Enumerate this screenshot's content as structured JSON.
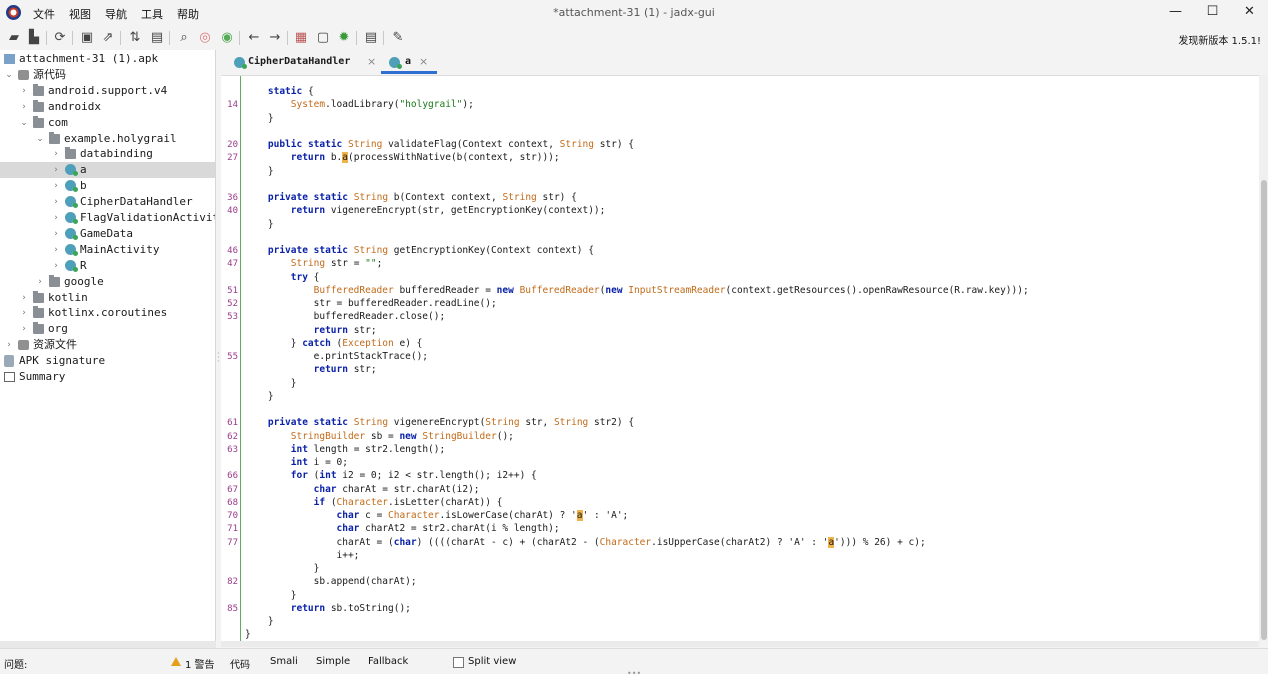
{
  "window": {
    "title": "*attachment-31 (1) - jadx-gui",
    "menu": [
      "文件",
      "视图",
      "导航",
      "工具",
      "帮助"
    ],
    "controls": {
      "minimize": "—",
      "maximize": "☐",
      "close": "✕"
    }
  },
  "toolbar": {
    "icons": [
      "open-file-icon",
      "add-files-icon",
      "reload-icon",
      "save-icon",
      "export-icon",
      "sync-tree-icon",
      "flatten-packages-icon",
      "search-icon",
      "find-class-icon",
      "find-usage-icon",
      "back-icon",
      "forward-icon",
      "deobfuscation-icon",
      "quick-tabs-icon",
      "debugger-icon",
      "log-viewer-icon",
      "preferences-icon"
    ],
    "update_notice": "发现新版本 1.5.1!"
  },
  "tree": {
    "items": [
      {
        "label": "attachment-31 (1).apk",
        "icon": "apk-icon",
        "depth": 0,
        "arrow": ""
      },
      {
        "label": "源代码",
        "icon": "package-icon",
        "depth": 0,
        "arrow": "⌄"
      },
      {
        "label": "android.support.v4",
        "icon": "folder-icon",
        "depth": 1,
        "arrow": "›"
      },
      {
        "label": "androidx",
        "icon": "folder-icon",
        "depth": 1,
        "arrow": "›"
      },
      {
        "label": "com",
        "icon": "folder-icon",
        "depth": 1,
        "arrow": "⌄"
      },
      {
        "label": "example.holygrail",
        "icon": "folder-icon",
        "depth": 2,
        "arrow": "⌄"
      },
      {
        "label": "databinding",
        "icon": "folder-icon",
        "depth": 3,
        "arrow": "›"
      },
      {
        "label": "a",
        "icon": "class-icon",
        "depth": 3,
        "arrow": "›",
        "selected": true
      },
      {
        "label": "b",
        "icon": "class-icon",
        "depth": 3,
        "arrow": "›"
      },
      {
        "label": "CipherDataHandler",
        "icon": "class-icon",
        "depth": 3,
        "arrow": "›"
      },
      {
        "label": "FlagValidationActivit",
        "icon": "class-icon",
        "depth": 3,
        "arrow": "›"
      },
      {
        "label": "GameData",
        "icon": "class-icon",
        "depth": 3,
        "arrow": "›"
      },
      {
        "label": "MainActivity",
        "icon": "class-icon",
        "depth": 3,
        "arrow": "›"
      },
      {
        "label": "R",
        "icon": "class-icon",
        "depth": 3,
        "arrow": "›"
      },
      {
        "label": "google",
        "icon": "folder-icon",
        "depth": 2,
        "arrow": "›"
      },
      {
        "label": "kotlin",
        "icon": "folder-icon",
        "depth": 1,
        "arrow": "›"
      },
      {
        "label": "kotlinx.coroutines",
        "icon": "folder-icon",
        "depth": 1,
        "arrow": "›"
      },
      {
        "label": "org",
        "icon": "folder-icon",
        "depth": 1,
        "arrow": "›"
      },
      {
        "label": "资源文件",
        "icon": "package-icon",
        "depth": 0,
        "arrow": "›"
      },
      {
        "label": "APK signature",
        "icon": "signature-icon",
        "depth": 0,
        "arrow": ""
      },
      {
        "label": "Summary",
        "icon": "summary-icon",
        "depth": 0,
        "arrow": ""
      }
    ]
  },
  "tabs": [
    {
      "label": "CipherDataHandler",
      "close": "×",
      "active": false
    },
    {
      "label": "a",
      "close": "×",
      "active": true
    }
  ],
  "code": {
    "lines": [
      {
        "num": "",
        "text": "    static {"
      },
      {
        "num": "14",
        "text": "        System.loadLibrary(\"holygrail\");"
      },
      {
        "num": "",
        "text": "    }"
      },
      {
        "num": "",
        "text": ""
      },
      {
        "num": "20",
        "text": "    public static String validateFlag(Context context, String str) {"
      },
      {
        "num": "27",
        "text": "        return b.a(processWithNative(b(context, str)));"
      },
      {
        "num": "",
        "text": "    }"
      },
      {
        "num": "",
        "text": ""
      },
      {
        "num": "36",
        "text": "    private static String b(Context context, String str) {"
      },
      {
        "num": "40",
        "text": "        return vigenereEncrypt(str, getEncryptionKey(context));"
      },
      {
        "num": "",
        "text": "    }"
      },
      {
        "num": "",
        "text": ""
      },
      {
        "num": "46",
        "text": "    private static String getEncryptionKey(Context context) {"
      },
      {
        "num": "47",
        "text": "        String str = \"\";"
      },
      {
        "num": "",
        "text": "        try {"
      },
      {
        "num": "51",
        "text": "            BufferedReader bufferedReader = new BufferedReader(new InputStreamReader(context.getResources().openRawResource(R.raw.key)));"
      },
      {
        "num": "52",
        "text": "            str = bufferedReader.readLine();"
      },
      {
        "num": "53",
        "text": "            bufferedReader.close();"
      },
      {
        "num": "",
        "text": "            return str;"
      },
      {
        "num": "",
        "text": "        } catch (Exception e) {"
      },
      {
        "num": "55",
        "text": "            e.printStackTrace();"
      },
      {
        "num": "",
        "text": "            return str;"
      },
      {
        "num": "",
        "text": "        }"
      },
      {
        "num": "",
        "text": "    }"
      },
      {
        "num": "",
        "text": ""
      },
      {
        "num": "61",
        "text": "    private static String vigenereEncrypt(String str, String str2) {"
      },
      {
        "num": "62",
        "text": "        StringBuilder sb = new StringBuilder();"
      },
      {
        "num": "63",
        "text": "        int length = str2.length();"
      },
      {
        "num": "",
        "text": "        int i = 0;"
      },
      {
        "num": "66",
        "text": "        for (int i2 = 0; i2 < str.length(); i2++) {"
      },
      {
        "num": "67",
        "text": "            char charAt = str.charAt(i2);"
      },
      {
        "num": "68",
        "text": "            if (Character.isLetter(charAt)) {"
      },
      {
        "num": "70",
        "text": "                char c = Character.isLowerCase(charAt) ? 'a' : 'A';"
      },
      {
        "num": "71",
        "text": "                char charAt2 = str2.charAt(i % length);"
      },
      {
        "num": "77",
        "text": "                charAt = (char) ((((charAt - c) + (charAt2 - (Character.isUpperCase(charAt2) ? 'A' : 'a'))) % 26) + c);"
      },
      {
        "num": "",
        "text": "                i++;"
      },
      {
        "num": "",
        "text": "            }"
      },
      {
        "num": "82",
        "text": "            sb.append(charAt);"
      },
      {
        "num": "",
        "text": "        }"
      },
      {
        "num": "85",
        "text": "        return sb.toString();"
      },
      {
        "num": "",
        "text": "    }"
      },
      {
        "num": "",
        "text": "}"
      }
    ]
  },
  "status": {
    "problems_label": "问题:",
    "warning_count": "1 警告",
    "view_tabs": [
      "代码",
      "Smali",
      "Simple",
      "Fallback"
    ],
    "split_view_label": "Split view"
  },
  "colors": {
    "keyword": "#0b22a8",
    "type": "#c26b1a",
    "string": "#1a7a1a",
    "accent": "#2f6fd1",
    "gutter": "#5cae5c"
  }
}
